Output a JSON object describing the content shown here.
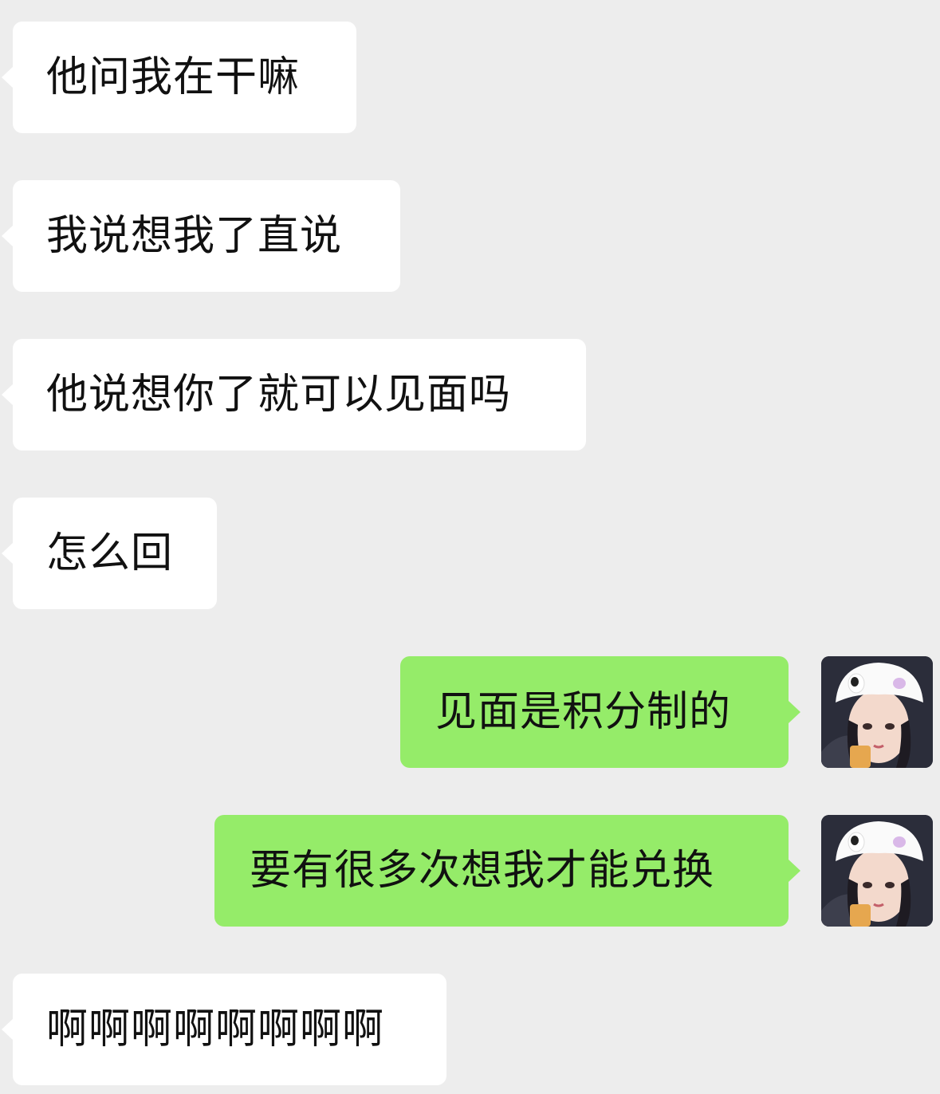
{
  "messages": [
    {
      "from": "other",
      "text": "他问我在干嘛"
    },
    {
      "from": "other",
      "text": "我说想我了直说"
    },
    {
      "from": "other",
      "text": "他说想你了就可以见面吗"
    },
    {
      "from": "other",
      "text": "怎么回"
    },
    {
      "from": "self",
      "text": "见面是积分制的"
    },
    {
      "from": "self",
      "text": "要有很多次想我才能兑换"
    },
    {
      "from": "other",
      "text": "啊啊啊啊啊啊啊啊"
    }
  ],
  "colors": {
    "background": "#ededed",
    "incoming_bubble": "#ffffff",
    "outgoing_bubble": "#95ec69",
    "text": "#111111"
  },
  "self_avatar_icon": "user-avatar-photo"
}
